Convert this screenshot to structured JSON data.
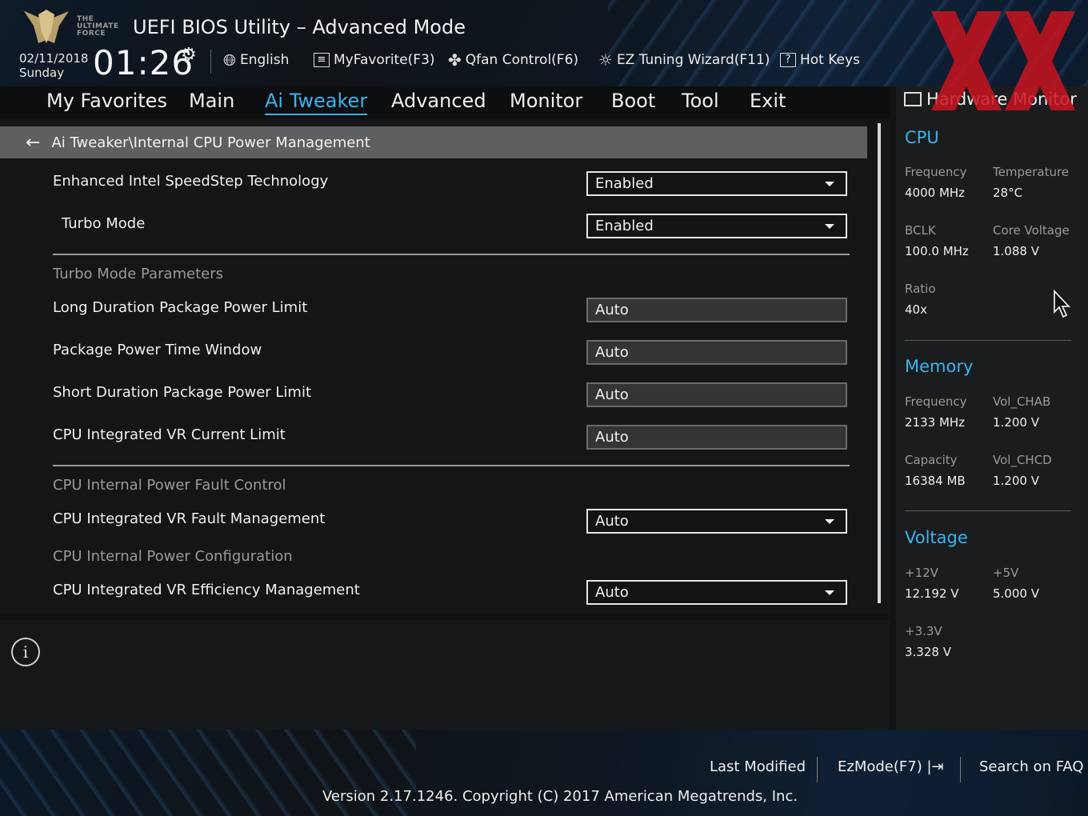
{
  "header": {
    "logo_lines": [
      "THE",
      "ULTIMATE",
      "FORCE"
    ],
    "title": "UEFI BIOS Utility – Advanced Mode",
    "date": "02/11/2018",
    "day": "Sunday",
    "time": "01:26",
    "tools": {
      "language": "English",
      "myfavorite": "MyFavorite(F3)",
      "qfan": "Qfan Control(F6)",
      "ez_tuning": "EZ Tuning Wizard(F11)",
      "hotkeys": "Hot Keys"
    }
  },
  "nav": {
    "tabs": [
      "My Favorites",
      "Main",
      "Ai Tweaker",
      "Advanced",
      "Monitor",
      "Boot",
      "Tool",
      "Exit"
    ],
    "active": "Ai Tweaker"
  },
  "main": {
    "breadcrumb": "Ai Tweaker\\Internal CPU Power Management",
    "rows": {
      "speedstep": {
        "label": "Enhanced Intel SpeedStep Technology",
        "value": "Enabled"
      },
      "turbo_mode": {
        "label": "Turbo Mode",
        "value": "Enabled"
      },
      "turbo_section": "Turbo Mode Parameters",
      "long_duration": {
        "label": "Long Duration Package Power Limit",
        "value": "Auto"
      },
      "time_window": {
        "label": "Package Power Time Window",
        "value": "Auto"
      },
      "short_duration": {
        "label": "Short Duration Package Power Limit",
        "value": "Auto"
      },
      "vr_current": {
        "label": "CPU Integrated VR Current Limit",
        "value": "Auto"
      },
      "fault_section": "CPU Internal Power Fault Control",
      "vr_fault": {
        "label": "CPU Integrated VR Fault Management",
        "value": "Auto"
      },
      "config_section": "CPU Internal Power Configuration",
      "vr_efficiency": {
        "label": "CPU Integrated VR Efficiency Management",
        "value": "Auto"
      }
    }
  },
  "hwmon": {
    "title": "Hardware Monitor",
    "cpu": {
      "heading": "CPU",
      "frequency_label": "Frequency",
      "frequency": "4000 MHz",
      "temperature_label": "Temperature",
      "temperature": "28°C",
      "bclk_label": "BCLK",
      "bclk": "100.0 MHz",
      "core_voltage_label": "Core Voltage",
      "core_voltage": "1.088 V",
      "ratio_label": "Ratio",
      "ratio": "40x"
    },
    "memory": {
      "heading": "Memory",
      "frequency_label": "Frequency",
      "frequency": "2133 MHz",
      "vol_chab_label": "Vol_CHAB",
      "vol_chab": "1.200 V",
      "capacity_label": "Capacity",
      "capacity": "16384 MB",
      "vol_chcd_label": "Vol_CHCD",
      "vol_chcd": "1.200 V"
    },
    "voltage": {
      "heading": "Voltage",
      "v12_label": "+12V",
      "v12": "12.192 V",
      "v5_label": "+5V",
      "v5": "5.000 V",
      "v33_label": "+3.3V",
      "v33": "3.328 V"
    }
  },
  "footer": {
    "last_modified": "Last Modified",
    "ezmode": "EzMode(F7)",
    "search_faq": "Search on FAQ",
    "version": "Version 2.17.1246. Copyright (C) 2017 American Megatrends, Inc."
  },
  "colors": {
    "accent": "#3ab3f0",
    "watermark_red": "#c8141e"
  }
}
